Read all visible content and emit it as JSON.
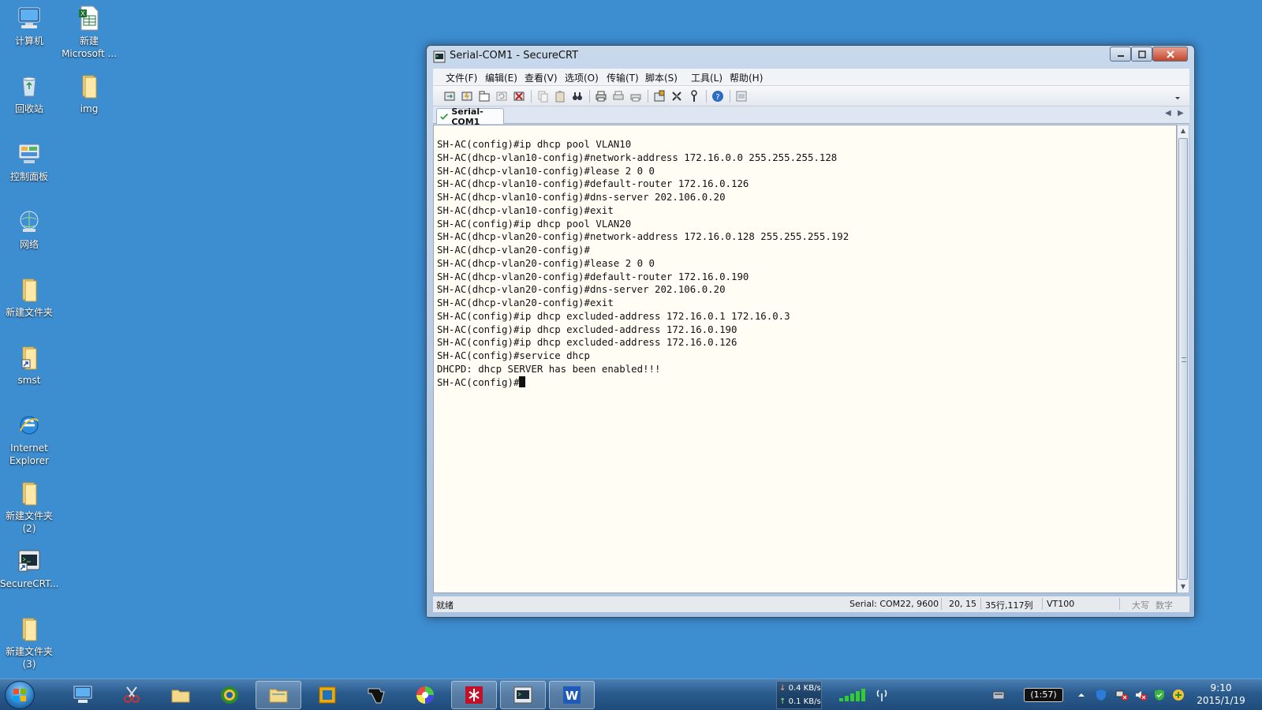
{
  "desktop": {
    "icons": [
      {
        "label": "计算机",
        "icon": "computer-icon"
      },
      {
        "label": "新建\nMicrosoft ...",
        "icon": "excel-file-icon"
      },
      {
        "label": "回收站",
        "icon": "recycle-bin-icon"
      },
      {
        "label": "img",
        "icon": "folder-icon"
      },
      {
        "label": "控制面板",
        "icon": "control-panel-icon"
      },
      {
        "label": "网络",
        "icon": "network-icon"
      },
      {
        "label": "新建文件夹",
        "icon": "folder-icon"
      },
      {
        "label": "smst",
        "icon": "shortcut-icon"
      },
      {
        "label": "Internet\nExplorer",
        "icon": "internet-explorer-icon"
      },
      {
        "label": "新建文件夹\n(2)",
        "icon": "folder-icon"
      },
      {
        "label": "SecureCRT...",
        "icon": "securecrt-icon"
      },
      {
        "label": "新建文件夹\n(3)",
        "icon": "folder-icon"
      }
    ]
  },
  "window": {
    "title": "Serial-COM1 - SecureCRT",
    "menu": [
      "文件(F)",
      "编辑(E)",
      "查看(V)",
      "选项(O)",
      "传输(T)",
      "脚本(S)",
      "工具(L)",
      "帮助(H)"
    ],
    "tab": {
      "label": "Serial-COM1"
    },
    "terminal_lines": [
      "SH-AC(config)#ip dhcp pool VLAN10",
      "SH-AC(dhcp-vlan10-config)#network-address 172.16.0.0 255.255.255.128",
      "SH-AC(dhcp-vlan10-config)#lease 2 0 0",
      "SH-AC(dhcp-vlan10-config)#default-router 172.16.0.126",
      "SH-AC(dhcp-vlan10-config)#dns-server 202.106.0.20",
      "SH-AC(dhcp-vlan10-config)#exit",
      "SH-AC(config)#ip dhcp pool VLAN20",
      "SH-AC(dhcp-vlan20-config)#network-address 172.16.0.128 255.255.255.192",
      "SH-AC(dhcp-vlan20-config)#",
      "SH-AC(dhcp-vlan20-config)#lease 2 0 0",
      "SH-AC(dhcp-vlan20-config)#default-router 172.16.0.190",
      "SH-AC(dhcp-vlan20-config)#dns-server 202.106.0.20",
      "SH-AC(dhcp-vlan20-config)#exit",
      "SH-AC(config)#ip dhcp excluded-address 172.16.0.1 172.16.0.3",
      "SH-AC(config)#ip dhcp excluded-address 172.16.0.190",
      "SH-AC(config)#ip dhcp excluded-address 172.16.0.126",
      "SH-AC(config)#service dhcp",
      "DHCPD: dhcp SERVER has been enabled!!!"
    ],
    "prompt": "SH-AC(config)#",
    "status": {
      "ready": "就绪",
      "connection": "Serial: COM22, 9600",
      "cursor_pos": "20, 15",
      "size": "35行,117列",
      "emulation": "VT100",
      "caps": "大写",
      "num": "数字"
    }
  },
  "taskbar": {
    "net_down": "0.4 KB/s",
    "net_up": "0.1 KB/s",
    "battery": "(1:57)",
    "time": "9:10",
    "date": "2015/1/19"
  },
  "colors": {
    "desktop_bg": "#3d8dd1",
    "terminal_bg": "#fffdf4"
  }
}
